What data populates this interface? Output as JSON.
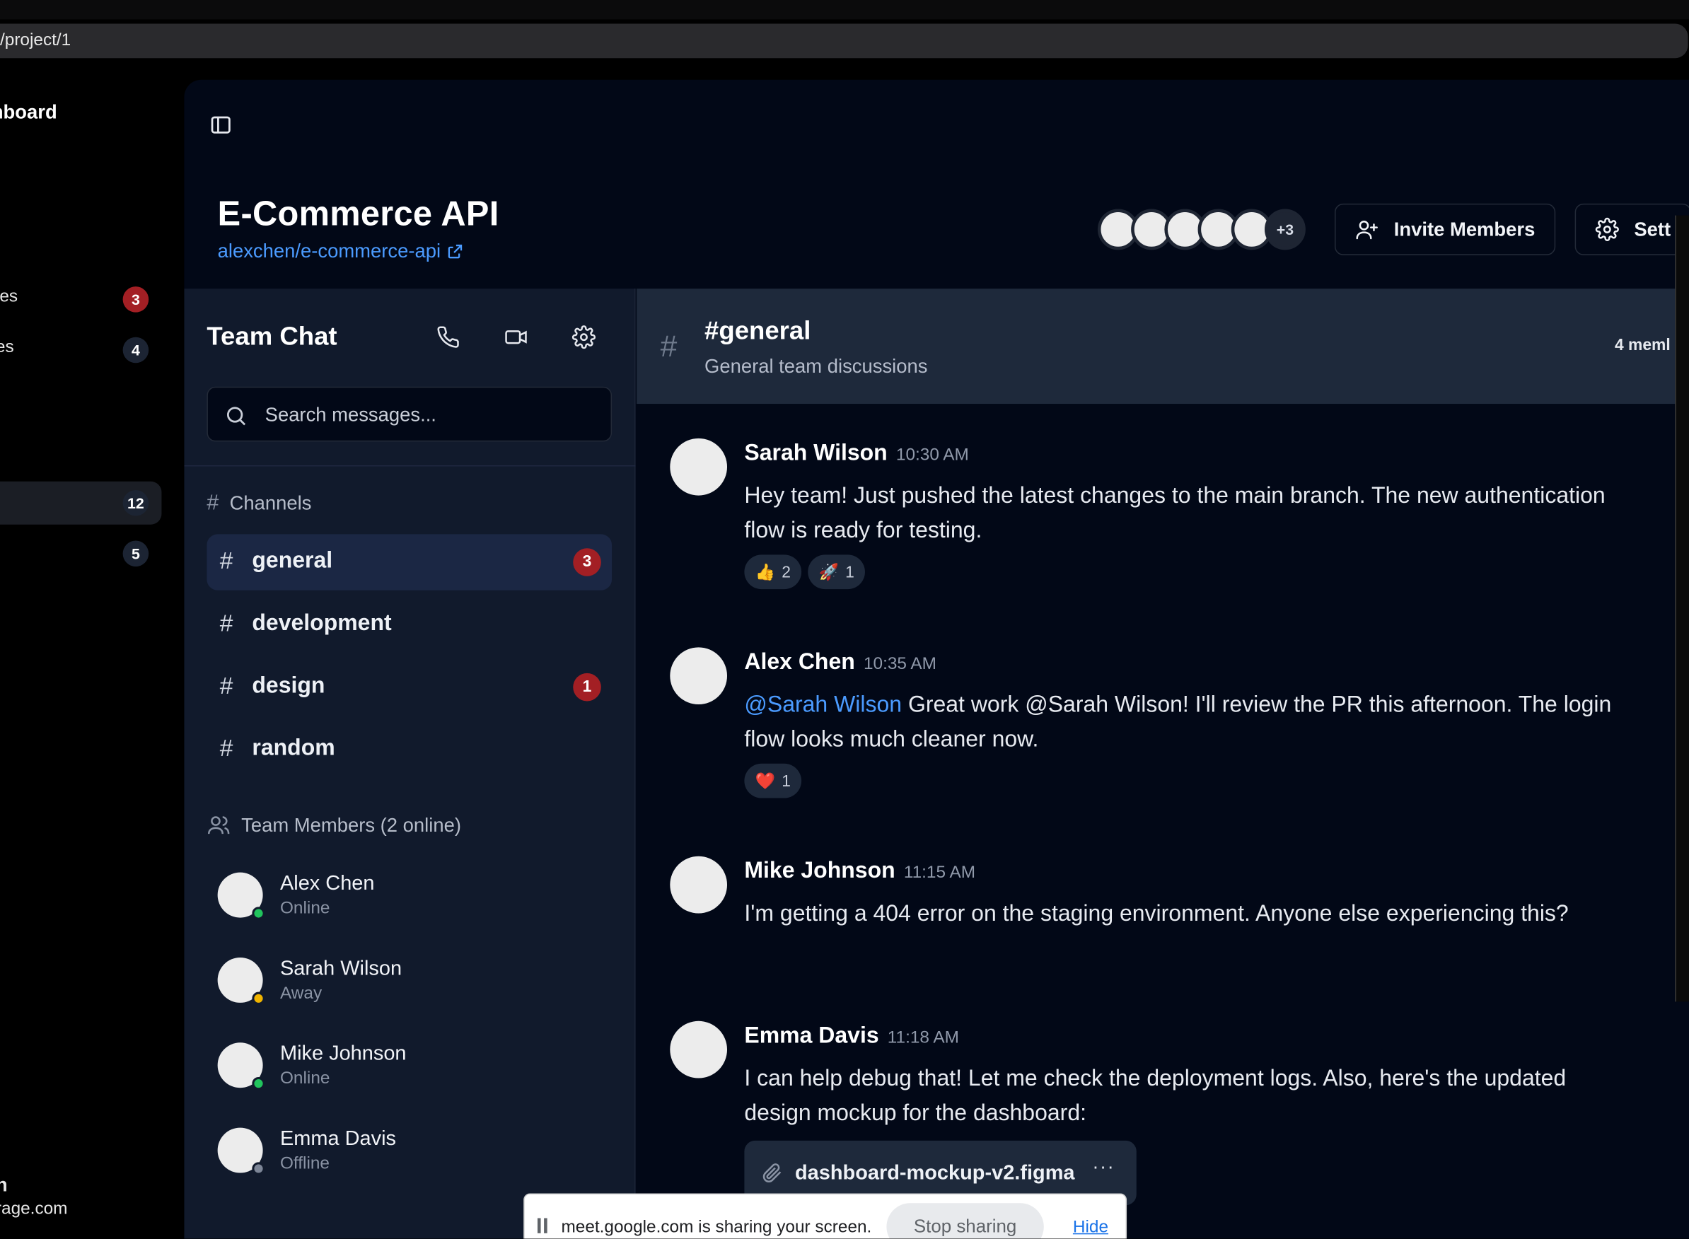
{
  "browser": {
    "url_fragment": "/project/1"
  },
  "nav": {
    "title": "hboard",
    "items": [
      {
        "label": "ies",
        "badge": "3",
        "badge_color": "#a31f24"
      },
      {
        "label": "es",
        "badge": "4",
        "badge_color": "#1c2433"
      },
      {
        "label": "",
        "badge": "12",
        "badge_color": "#1c2433"
      },
      {
        "label": "",
        "badge": "5",
        "badge_color": "#1c2433"
      }
    ],
    "user_initial": "n",
    "user_email": "rage.com"
  },
  "project": {
    "title": "E-Commerce API",
    "repo": "alexchen/e-commerce-api",
    "avatar_more": "+3",
    "invite_label": "Invite Members",
    "settings_label": "Sett"
  },
  "chat": {
    "title": "Team Chat",
    "icons": [
      "phone-icon",
      "video-icon",
      "gear-icon"
    ],
    "search_placeholder": "Search messages...",
    "channels_heading": "Channels",
    "channels": [
      {
        "name": "general",
        "badge": "3",
        "active": true
      },
      {
        "name": "development",
        "badge": "",
        "active": false
      },
      {
        "name": "design",
        "badge": "1",
        "active": false
      },
      {
        "name": "random",
        "badge": "",
        "active": false
      }
    ],
    "members_heading": "Team Members (2 online)",
    "members": [
      {
        "name": "Alex Chen",
        "status": "Online"
      },
      {
        "name": "Sarah Wilson",
        "status": "Away"
      },
      {
        "name": "Mike Johnson",
        "status": "Online"
      },
      {
        "name": "Emma Davis",
        "status": "Offline"
      }
    ]
  },
  "channel": {
    "name": "#general",
    "description": "General team discussions",
    "members_count": "4 meml"
  },
  "messages": [
    {
      "author": "Sarah Wilson",
      "time": "10:30 AM",
      "text": "Hey team! Just pushed the latest changes to the main branch. The new authentication flow is ready for testing.",
      "reactions": [
        {
          "emoji": "👍",
          "count": "2"
        },
        {
          "emoji": "🚀",
          "count": "1"
        }
      ]
    },
    {
      "author": "Alex Chen",
      "time": "10:35 AM",
      "mention": "@Sarah Wilson",
      "text": " Great work @Sarah Wilson! I'll review the PR this afternoon. The login flow looks much cleaner now.",
      "reactions": [
        {
          "emoji": "❤️",
          "count": "1"
        }
      ]
    },
    {
      "author": "Mike Johnson",
      "time": "11:15 AM",
      "text": "I'm getting a 404 error on the staging environment. Anyone else experiencing this?"
    },
    {
      "author": "Emma Davis",
      "time": "11:18 AM",
      "text": "I can help debug that! Let me check the deployment logs. Also, here's the updated design mockup for the dashboard:",
      "attachment": {
        "filename": "dashboard-mockup-v2.figma",
        "more": "···"
      }
    }
  ],
  "screen_share": {
    "message": "meet.google.com is sharing your screen.",
    "stop_label": "Stop sharing",
    "hide_label": "Hide"
  },
  "colors": {
    "accent": "#4b9bff",
    "badge_red": "#a31f24",
    "online": "#21c45d",
    "away": "#f0b400",
    "offline": "#7d8697"
  }
}
